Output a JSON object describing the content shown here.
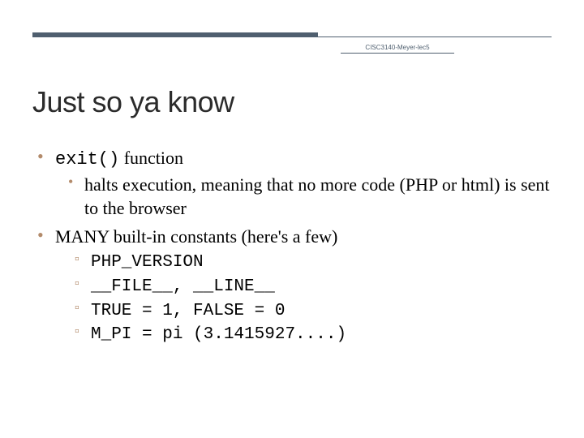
{
  "header": {
    "meta": "CISC3140-Meyer-lec5"
  },
  "title": "Just so ya know",
  "bullets": {
    "b1_code": "exit()",
    "b1_rest": " function",
    "b1_sub": "halts execution, meaning that no more code (PHP or html) is sent to the browser",
    "b2": "MANY built-in constants (here's a few)",
    "c1": "PHP_VERSION",
    "c2": "__FILE__, __LINE__",
    "c3": "TRUE = 1, FALSE = 0",
    "c4": "M_PI = pi (3.1415927....)"
  }
}
